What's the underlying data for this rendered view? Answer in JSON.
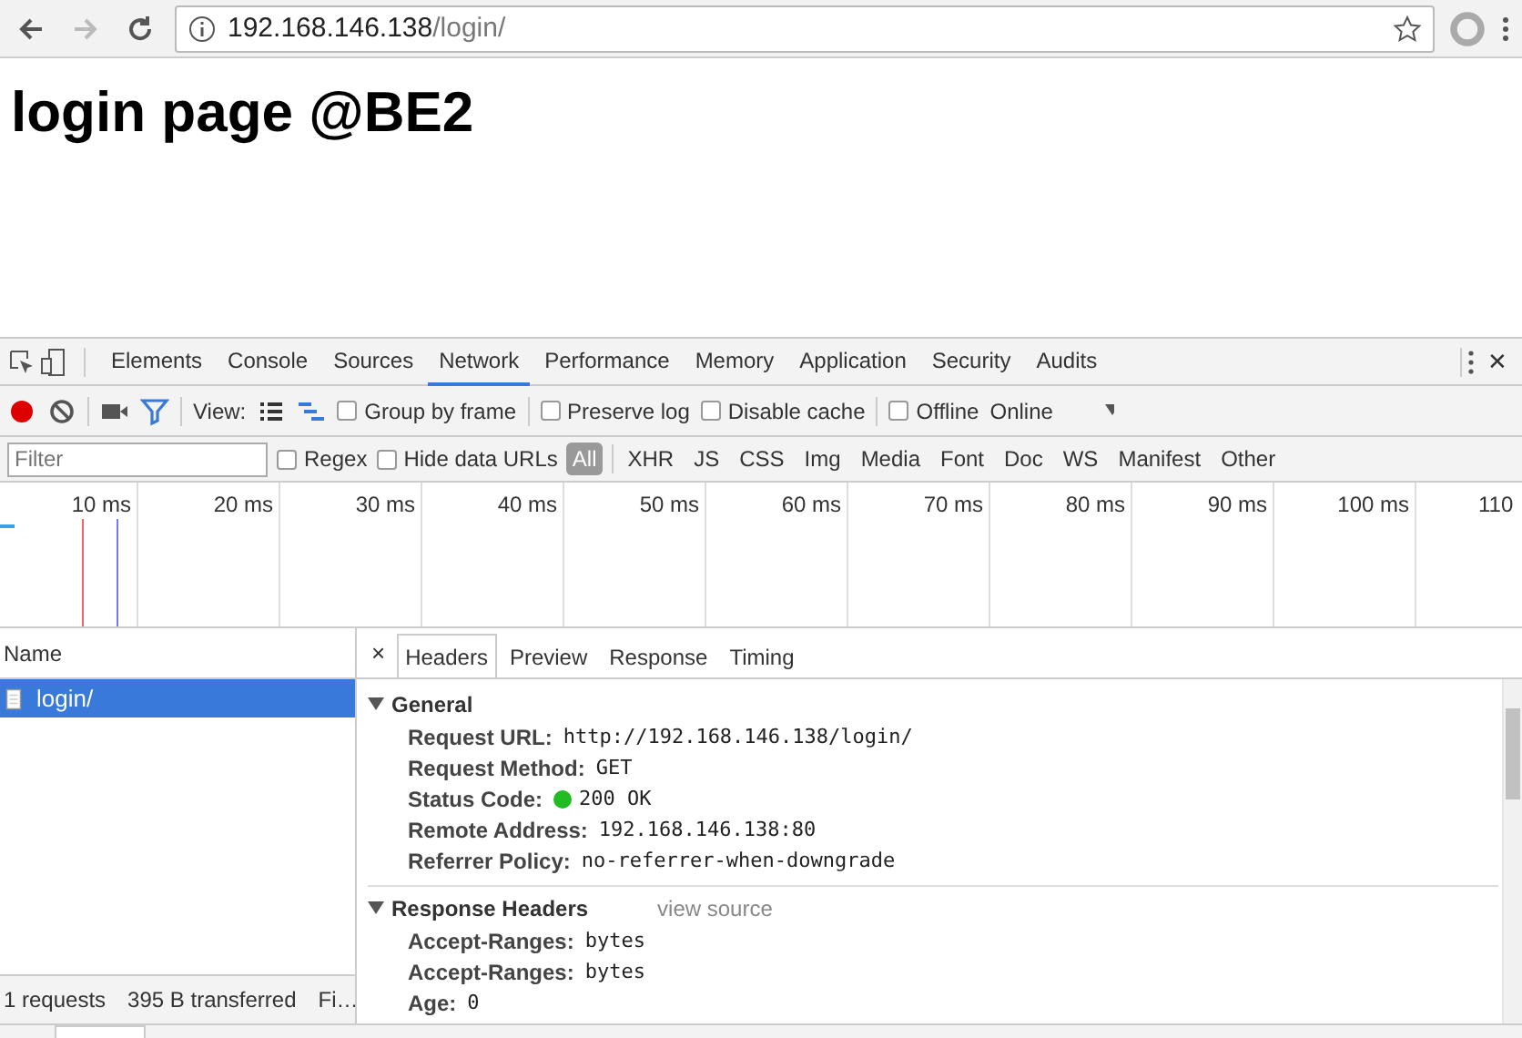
{
  "browser": {
    "url_host": "192.168.146.138",
    "url_path": "/login/"
  },
  "page": {
    "heading": "login page @BE2"
  },
  "devtools": {
    "tabs": [
      {
        "label": "Elements",
        "selected": false
      },
      {
        "label": "Console",
        "selected": false
      },
      {
        "label": "Sources",
        "selected": false
      },
      {
        "label": "Network",
        "selected": true
      },
      {
        "label": "Performance",
        "selected": false
      },
      {
        "label": "Memory",
        "selected": false
      },
      {
        "label": "Application",
        "selected": false
      },
      {
        "label": "Security",
        "selected": false
      },
      {
        "label": "Audits",
        "selected": false
      }
    ],
    "close": "✕",
    "toolbar": {
      "recording": true,
      "filter_on": true,
      "view_label": "View:",
      "options": [
        {
          "label": "Group by frame",
          "checked": false
        },
        {
          "label": "Preserve log",
          "checked": false
        },
        {
          "label": "Disable cache",
          "checked": false
        },
        {
          "label": "Offline",
          "checked": false
        }
      ],
      "throttle": "Online"
    },
    "filter": {
      "placeholder": "Filter",
      "options": [
        {
          "label": "Regex",
          "checked": false
        },
        {
          "label": "Hide data URLs",
          "checked": false
        }
      ],
      "types": [
        {
          "label": "All",
          "selected": true
        },
        {
          "label": "XHR",
          "selected": false
        },
        {
          "label": "JS",
          "selected": false
        },
        {
          "label": "CSS",
          "selected": false
        },
        {
          "label": "Img",
          "selected": false
        },
        {
          "label": "Media",
          "selected": false
        },
        {
          "label": "Font",
          "selected": false
        },
        {
          "label": "Doc",
          "selected": false
        },
        {
          "label": "WS",
          "selected": false
        },
        {
          "label": "Manifest",
          "selected": false
        },
        {
          "label": "Other",
          "selected": false
        }
      ]
    },
    "timeline": {
      "ticks": [
        "10 ms",
        "20 ms",
        "30 ms",
        "40 ms",
        "50 ms",
        "60 ms",
        "70 ms",
        "80 ms",
        "90 ms",
        "100 ms",
        "110"
      ]
    },
    "requests": {
      "column": "Name",
      "rows": [
        {
          "name": "login/",
          "selected": true
        }
      ],
      "status": [
        "1 requests",
        "395 B transferred",
        "Fi…"
      ]
    },
    "details": {
      "close": "×",
      "tabs": [
        {
          "label": "Headers",
          "selected": true
        },
        {
          "label": "Preview",
          "selected": false
        },
        {
          "label": "Response",
          "selected": false
        },
        {
          "label": "Timing",
          "selected": false
        }
      ],
      "sections": [
        {
          "title": "General",
          "expanded": true,
          "rows": [
            {
              "name": "Request URL:",
              "value": "http://192.168.146.138/login/"
            },
            {
              "name": "Request Method:",
              "value": "GET"
            },
            {
              "name": "Status Code:",
              "value": "200 OK",
              "color": "#22bb22"
            },
            {
              "name": "Remote Address:",
              "value": "192.168.146.138:80"
            },
            {
              "name": "Referrer Policy:",
              "value": "no-referrer-when-downgrade"
            }
          ]
        },
        {
          "title": "Response Headers",
          "expanded": true,
          "link": "view source",
          "rows": [
            {
              "name": "Accept-Ranges:",
              "value": "bytes"
            },
            {
              "name": "Accept-Ranges:",
              "value": "bytes"
            },
            {
              "name": "Age:",
              "value": "0"
            }
          ]
        }
      ]
    }
  }
}
